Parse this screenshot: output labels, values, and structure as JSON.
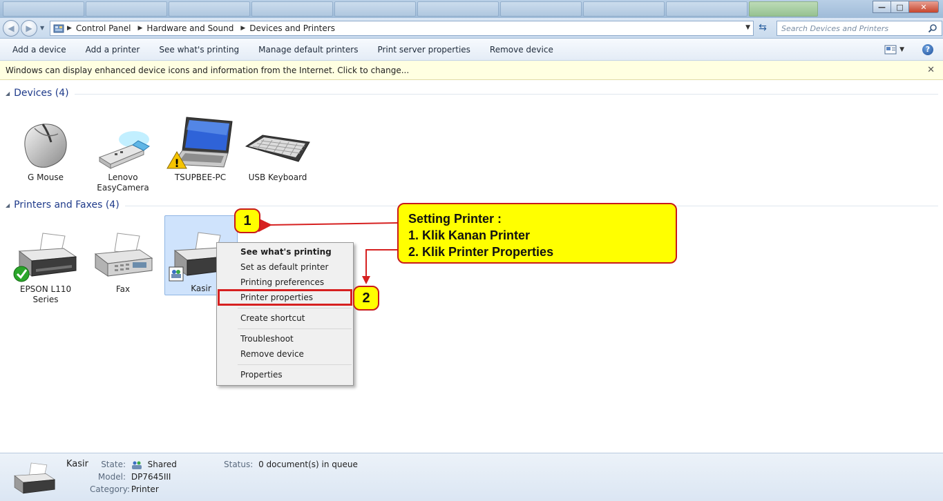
{
  "window": {
    "min": "—",
    "max": "□",
    "close": "✕"
  },
  "address": {
    "crumbs": [
      "Control Panel",
      "Hardware and Sound",
      "Devices and Printers"
    ],
    "search_placeholder": "Search Devices and Printers"
  },
  "toolbar": {
    "add_device": "Add a device",
    "add_printer": "Add a printer",
    "see_printing": "See what's printing",
    "manage_default": "Manage default printers",
    "print_server": "Print server properties",
    "remove_device": "Remove device"
  },
  "info_bar": {
    "text": "Windows can display enhanced device icons and information from the Internet. Click to change..."
  },
  "devices_group": {
    "title": "Devices (4)",
    "items": [
      {
        "label": "G Mouse",
        "icon": "mouse-icon"
      },
      {
        "label": "Lenovo EasyCamera",
        "icon": "usb-camera-icon"
      },
      {
        "label": "TSUPBEE-PC",
        "icon": "laptop-icon"
      },
      {
        "label": "USB Keyboard",
        "icon": "keyboard-icon"
      }
    ]
  },
  "printers_group": {
    "title": "Printers and Faxes (4)",
    "items": [
      {
        "label": "EPSON L110 Series",
        "icon": "printer-icon",
        "default": true
      },
      {
        "label": "Fax",
        "icon": "fax-icon"
      },
      {
        "label": "Kasir",
        "icon": "printer-icon",
        "shared": true
      }
    ]
  },
  "context_menu": {
    "items": [
      "See what's printing",
      "Set as default printer",
      "Printing preferences",
      "Printer properties",
      "Create shortcut",
      "Troubleshoot",
      "Remove device",
      "Properties"
    ]
  },
  "annotation": {
    "title": "Setting Printer :",
    "step1": "1. Klik Kanan Printer",
    "step2": "2. Klik Printer Properties",
    "badge1": "1",
    "badge2": "2",
    "color": "#ffff00",
    "border_color": "#c81a1a"
  },
  "details": {
    "name": "Kasir",
    "state_label": "State:",
    "state_value": "Shared",
    "model_label": "Model:",
    "model_value": "DP7645III",
    "category_label": "Category:",
    "category_value": "Printer",
    "status_label": "Status:",
    "status_value": "0 document(s) in queue"
  }
}
